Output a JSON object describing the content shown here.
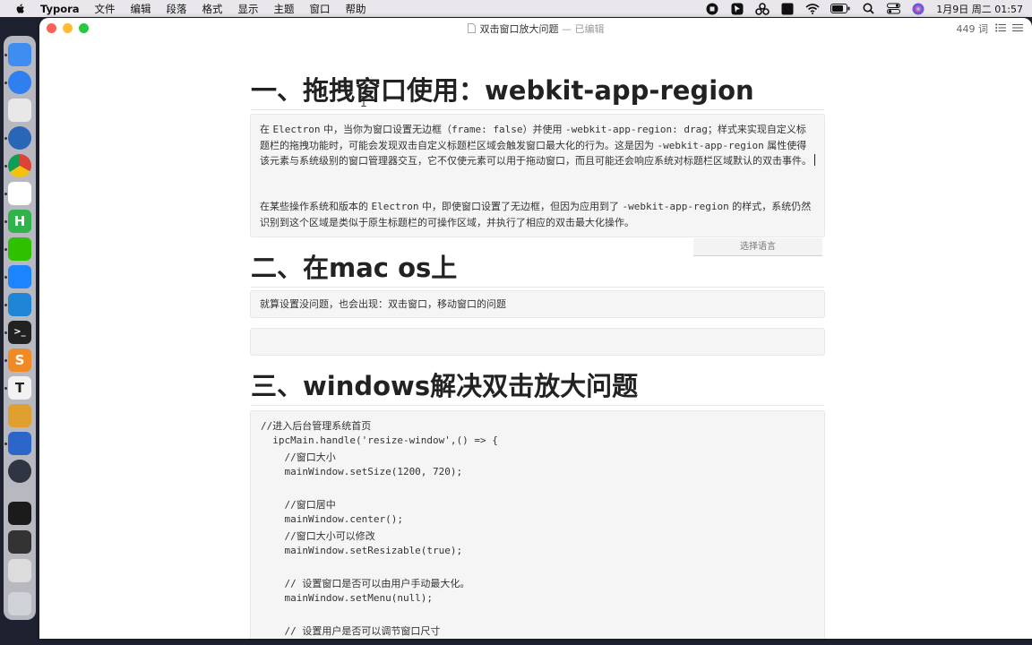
{
  "menubar": {
    "app": "Typora",
    "items": [
      "文件",
      "编辑",
      "段落",
      "格式",
      "显示",
      "主题",
      "窗口",
      "帮助"
    ],
    "datetime": "1月9日 周二  01:57",
    "input_icon": "A"
  },
  "window": {
    "title": "双击窗口放大问题",
    "separator": "—",
    "status": "已编辑",
    "word_count": "449 词",
    "traffic_colors": [
      "#ff5f57",
      "#febc2e",
      "#28c840"
    ]
  },
  "doc": {
    "h1_1": "一、拖拽窗口使用：webkit-app-region",
    "p1": [
      {
        "t": "在 "
      },
      {
        "t": "Electron",
        "m": true
      },
      {
        "t": " 中，当你为窗口设置无边框（"
      },
      {
        "t": "frame: false",
        "m": true
      },
      {
        "t": "）并使用 "
      },
      {
        "t": "-webkit-app-region: drag",
        "m": true
      },
      {
        "t": "；样式来实现自定义标题栏的拖拽功能时，可能会发现双击自定义标题栏区域会触发窗口最大化的行为。这是因为 "
      },
      {
        "t": "-webkit-app-region",
        "m": true
      },
      {
        "t": " 属性使得该元素与系统级别的窗口管理器交互，它不仅使元素可以用于拖动窗口，而且可能还会响应系统对标题栏区域默认的双击事件。"
      }
    ],
    "p2": [
      {
        "t": "在某些操作系统和版本的 "
      },
      {
        "t": "Electron",
        "m": true
      },
      {
        "t": " 中，即使窗口设置了无边框，但因为应用到了 "
      },
      {
        "t": "-webkit-app-region",
        "m": true
      },
      {
        "t": " 的样式，系统仍然识别到这个区域是类似于原生标题栏的可操作区域，并执行了相应的双击最大化操作。"
      }
    ],
    "lang_select": "选择语言",
    "h1_2": "二、在mac os上",
    "p3": "就算设置没问题，也会出现：双击窗口，移动窗口的问题",
    "h1_3": "三、windows解决双击放大问题",
    "code": [
      "//进入后台管理系统首页",
      "  ipcMain.handle('resize-window',() => {",
      "    //窗口大小",
      "    mainWindow.setSize(1200, 720);",
      "",
      "    //窗口居中",
      "    mainWindow.center();",
      "    //窗口大小可以修改",
      "    mainWindow.setResizable(true);",
      "",
      "    // 设置窗口是否可以由用户手动最大化。",
      "    mainWindow.setMenu(null);",
      "",
      "    // 设置用户是否可以调节窗口尺寸"
    ]
  },
  "dock_apps": [
    {
      "name": "finder-icon",
      "color": "#3d8ef0"
    },
    {
      "name": "safari-icon",
      "color": "#2f7ff0"
    },
    {
      "name": "launchpad-icon",
      "color": "#e8e8e8"
    },
    {
      "name": "screenshot-app-icon",
      "color": "#2a66b8"
    },
    {
      "name": "chrome-icon",
      "color": "#ffffff"
    },
    {
      "name": "baidu-netdisk-icon",
      "color": "#ffffff"
    },
    {
      "name": "hbuilder-icon",
      "color": "#2fb34a"
    },
    {
      "name": "wechat-icon",
      "color": "#2dc100"
    },
    {
      "name": "lark-icon",
      "color": "#1b84ff"
    },
    {
      "name": "vscode-icon",
      "color": "#1f86d6"
    },
    {
      "name": "terminal-icon",
      "color": "#222222"
    },
    {
      "name": "sublime-text-icon",
      "color": "#f08a24"
    },
    {
      "name": "typora-icon",
      "color": "#f2f2f2"
    },
    {
      "name": "paint-icon",
      "color": "#e0a030"
    },
    {
      "name": "clashx-icon",
      "color": "#2b66c8"
    },
    {
      "name": "electron-icon",
      "color": "#2f3542"
    },
    {
      "name": "window-thumbnail-1",
      "color": "#1b1b1b"
    },
    {
      "name": "window-thumbnail-2",
      "color": "#333333"
    },
    {
      "name": "window-thumbnail-3",
      "color": "#dcdcdc"
    },
    {
      "name": "trash-icon",
      "color": "#cfd3d8"
    }
  ]
}
